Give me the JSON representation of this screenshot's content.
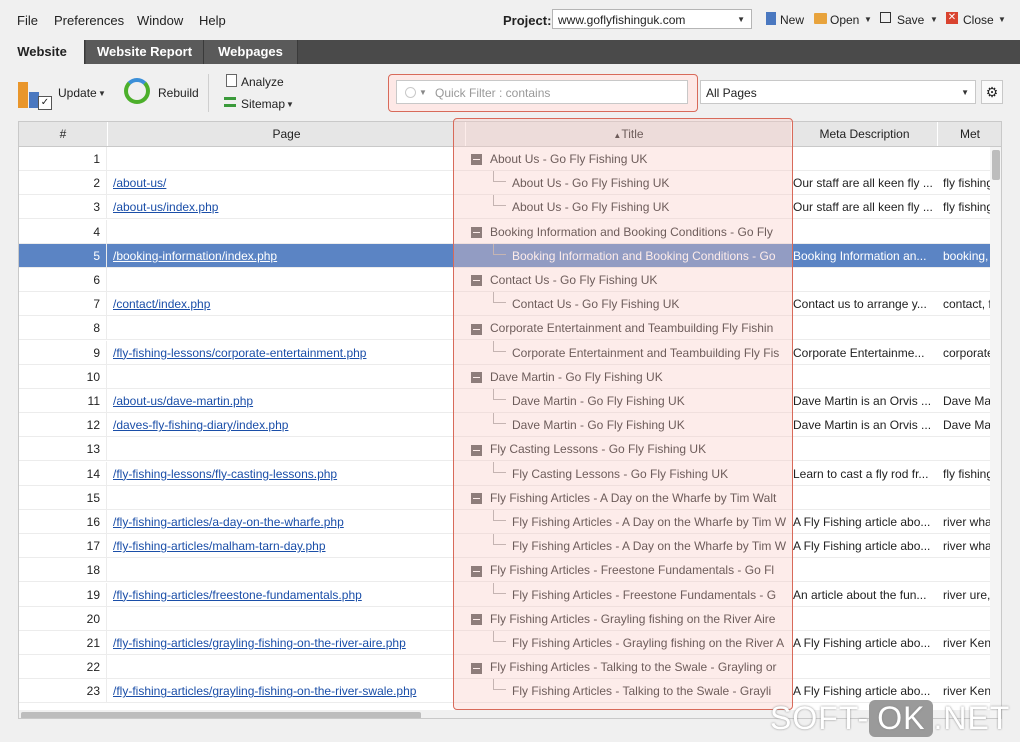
{
  "menu": {
    "items": [
      "File",
      "Preferences",
      "Window",
      "Help"
    ],
    "project_label": "Project:",
    "project_value": "www.goflyfishinguk.com",
    "new_label": "New",
    "open_label": "Open",
    "save_label": "Save",
    "close_label": "Close"
  },
  "tabs": [
    "Website",
    "Website Report",
    "Webpages"
  ],
  "toolbar": {
    "update_label": "Update",
    "rebuild_label": "Rebuild",
    "analyze_label": "Analyze",
    "sitemap_label": "Sitemap",
    "filter_placeholder": "Quick Filter : contains",
    "pages_select": "All Pages"
  },
  "columns": [
    "#",
    "Page",
    "Title",
    "Meta Description",
    "Met"
  ],
  "rows": [
    {
      "num": "1",
      "page": "",
      "title": "About Us - Go Fly Fishing UK",
      "meta": "",
      "kw": ""
    },
    {
      "num": "2",
      "page": "/about-us/",
      "title": "About Us - Go Fly Fishing UK",
      "meta": "Our staff are all keen fly ...",
      "kw": "fly fishing"
    },
    {
      "num": "3",
      "page": "/about-us/index.php",
      "title": "About Us - Go Fly Fishing UK",
      "meta": "Our staff are all keen fly ...",
      "kw": "fly fishing"
    },
    {
      "num": "4",
      "page": "",
      "title": "Booking Information and Booking Conditions - Go Fly",
      "meta": "",
      "kw": ""
    },
    {
      "num": "5",
      "page": "/booking-information/index.php",
      "title": "Booking Information and Booking Conditions - Go",
      "meta": "Booking Information an...",
      "kw": "booking,"
    },
    {
      "num": "6",
      "page": "",
      "title": "Contact Us - Go Fly Fishing UK",
      "meta": "",
      "kw": ""
    },
    {
      "num": "7",
      "page": "/contact/index.php",
      "title": "Contact Us - Go Fly Fishing UK",
      "meta": "Contact us to arrange y...",
      "kw": "contact, f"
    },
    {
      "num": "8",
      "page": "",
      "title": "Corporate Entertainment and Teambuilding Fly Fishin",
      "meta": "",
      "kw": ""
    },
    {
      "num": "9",
      "page": "/fly-fishing-lessons/corporate-entertainment.php",
      "title": "Corporate Entertainment and Teambuilding Fly Fis",
      "meta": "Corporate Entertainme...",
      "kw": "corporate"
    },
    {
      "num": "10",
      "page": "",
      "title": "Dave Martin - Go Fly Fishing UK",
      "meta": "",
      "kw": ""
    },
    {
      "num": "11",
      "page": "/about-us/dave-martin.php",
      "title": "Dave Martin - Go Fly Fishing UK",
      "meta": "Dave Martin is an Orvis ...",
      "kw": "Dave Ma"
    },
    {
      "num": "12",
      "page": "/daves-fly-fishing-diary/index.php",
      "title": "Dave Martin - Go Fly Fishing UK",
      "meta": "Dave Martin is an Orvis ...",
      "kw": "Dave Ma"
    },
    {
      "num": "13",
      "page": "",
      "title": "Fly Casting Lessons - Go Fly Fishing UK",
      "meta": "",
      "kw": ""
    },
    {
      "num": "14",
      "page": "/fly-fishing-lessons/fly-casting-lessons.php",
      "title": "Fly Casting Lessons - Go Fly Fishing UK",
      "meta": "Learn to cast a fly rod fr...",
      "kw": "fly fishing"
    },
    {
      "num": "15",
      "page": "",
      "title": "Fly Fishing Articles - A Day on the Wharfe by Tim Walt",
      "meta": "",
      "kw": ""
    },
    {
      "num": "16",
      "page": "/fly-fishing-articles/a-day-on-the-wharfe.php",
      "title": "Fly Fishing Articles - A Day on the Wharfe by Tim W",
      "meta": "A Fly Fishing article abo...",
      "kw": "river wha"
    },
    {
      "num": "17",
      "page": "/fly-fishing-articles/malham-tarn-day.php",
      "title": "Fly Fishing Articles - A Day on the Wharfe by Tim W",
      "meta": "A Fly Fishing article abo...",
      "kw": "river wha"
    },
    {
      "num": "18",
      "page": "",
      "title": "Fly Fishing Articles - Freestone Fundamentals - Go Fl",
      "meta": "",
      "kw": ""
    },
    {
      "num": "19",
      "page": "/fly-fishing-articles/freestone-fundamentals.php",
      "title": "Fly Fishing Articles - Freestone Fundamentals - G",
      "meta": "An article about the fun...",
      "kw": "river ure,"
    },
    {
      "num": "20",
      "page": "",
      "title": "Fly Fishing Articles - Grayling fishing on the River Aire",
      "meta": "",
      "kw": ""
    },
    {
      "num": "21",
      "page": "/fly-fishing-articles/grayling-fishing-on-the-river-aire.php",
      "title": "Fly Fishing Articles - Grayling fishing on the River A",
      "meta": "A Fly Fishing article abo...",
      "kw": "river Ken"
    },
    {
      "num": "22",
      "page": "",
      "title": "Fly Fishing Articles - Talking to the Swale - Grayling or",
      "meta": "",
      "kw": ""
    },
    {
      "num": "23",
      "page": "/fly-fishing-articles/grayling-fishing-on-the-river-swale.php",
      "title": "Fly Fishing Articles - Talking to the Swale - Grayli",
      "meta": "A Fly Fishing article abo...",
      "kw": "river Ken"
    }
  ],
  "selected_row": "5",
  "watermark": {
    "left": "SOFT-",
    "ok": "OK",
    "right": ".NET"
  }
}
